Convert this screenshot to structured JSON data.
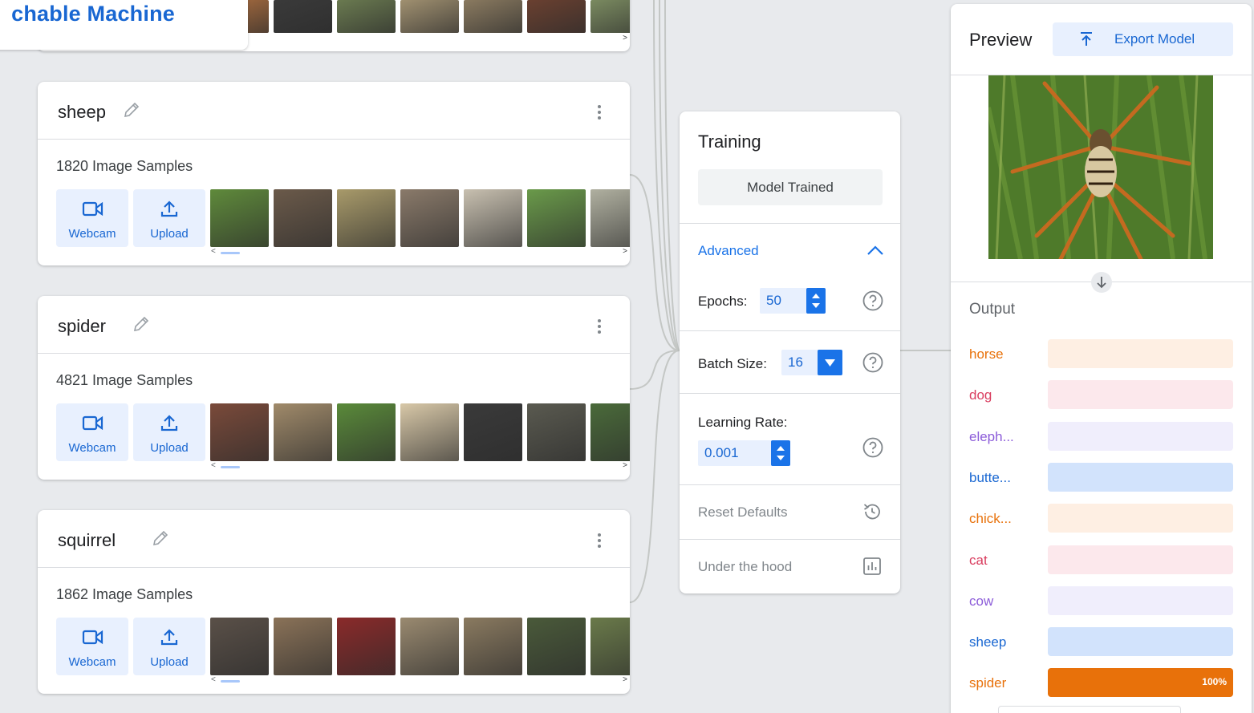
{
  "app": {
    "title_partial": "chable Machine"
  },
  "classes": [
    {
      "name": "sheep",
      "samples": "1820 Image Samples",
      "webcam": "Webcam",
      "upload": "Upload",
      "thumb_colors": [
        "#5f8a3b",
        "#6b5a4a",
        "#a89a6a",
        "#8a7a6a",
        "#c8c0b0",
        "#6a9a4a",
        "#b0b0a0"
      ]
    },
    {
      "name": "spider",
      "samples": "4821 Image Samples",
      "webcam": "Webcam",
      "upload": "Upload",
      "thumb_colors": [
        "#7a4a3a",
        "#a08a6a",
        "#5a8a3a",
        "#d8c8a8",
        "#3a3a3a",
        "#5a5a50",
        "#4a6a3a"
      ]
    },
    {
      "name": "squirrel",
      "samples": "1862 Image Samples",
      "webcam": "Webcam",
      "upload": "Upload",
      "thumb_colors": [
        "#5a5048",
        "#8a7258",
        "#8a2a2a",
        "#9a8a70",
        "#8a7a60",
        "#4a5a3a",
        "#6a7a4a"
      ]
    }
  ],
  "top_row_thumb_colors": [
    "#b07040",
    "#3a3a3a",
    "#6a7a50",
    "#a09070",
    "#8a7a60",
    "#6a4030",
    "#7a8a60"
  ],
  "training": {
    "title": "Training",
    "status_button": "Model Trained",
    "advanced_label": "Advanced",
    "epochs_label": "Epochs:",
    "epochs_value": "50",
    "batch_label": "Batch Size:",
    "batch_value": "16",
    "lr_label": "Learning Rate:",
    "lr_value": "0.001",
    "reset_label": "Reset Defaults",
    "hood_label": "Under the hood"
  },
  "preview": {
    "title": "Preview",
    "export_label": "Export Model",
    "output_title": "Output",
    "outputs": [
      {
        "label": "horse",
        "color": "#e8710a",
        "track": "#feefe3",
        "pct_value": 0,
        "pct_text": ""
      },
      {
        "label": "dog",
        "color": "#d93c5e",
        "track": "#fce8ec",
        "pct_value": 0,
        "pct_text": ""
      },
      {
        "label": "eleph...",
        "color": "#8c5cd9",
        "track": "#f0eefc",
        "pct_value": 0,
        "pct_text": ""
      },
      {
        "label": "butte...",
        "color": "#1967d2",
        "track": "#d2e3fc",
        "pct_value": 0,
        "pct_text": ""
      },
      {
        "label": "chick...",
        "color": "#e8710a",
        "track": "#feefe3",
        "pct_value": 0,
        "pct_text": ""
      },
      {
        "label": "cat",
        "color": "#d93c5e",
        "track": "#fce8ec",
        "pct_value": 0,
        "pct_text": ""
      },
      {
        "label": "cow",
        "color": "#8c5cd9",
        "track": "#f0eefc",
        "pct_value": 0,
        "pct_text": ""
      },
      {
        "label": "sheep",
        "color": "#1967d2",
        "track": "#d2e3fc",
        "pct_value": 0,
        "pct_text": ""
      },
      {
        "label": "spider",
        "color": "#e8710a",
        "track": "#feefe3",
        "pct_value": 100,
        "pct_text": "100%"
      }
    ]
  }
}
